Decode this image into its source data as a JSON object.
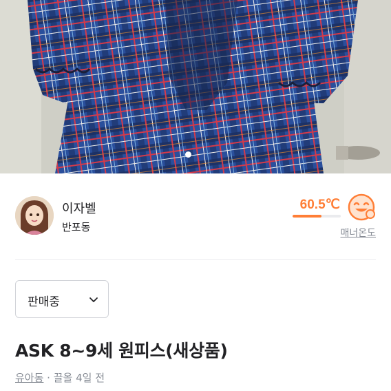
{
  "photo": {
    "description_icon": "plaid-dress-photo",
    "pager_dots": 1
  },
  "seller": {
    "nickname": "이자벨",
    "location": "반포동"
  },
  "manner": {
    "temperature": "60.5℃",
    "temperature_fraction": 0.605,
    "label": "매너온도",
    "icon": "smiling-face-icon"
  },
  "status_select": {
    "selected": "판매중"
  },
  "listing": {
    "title": "ASK 8~9세 원피스(새상품)",
    "category": "유아동",
    "separator": " · ",
    "time": "끌올 4일 전"
  },
  "colors": {
    "accent": "#ff7e36",
    "text": "#212124",
    "muted": "#868b94"
  }
}
